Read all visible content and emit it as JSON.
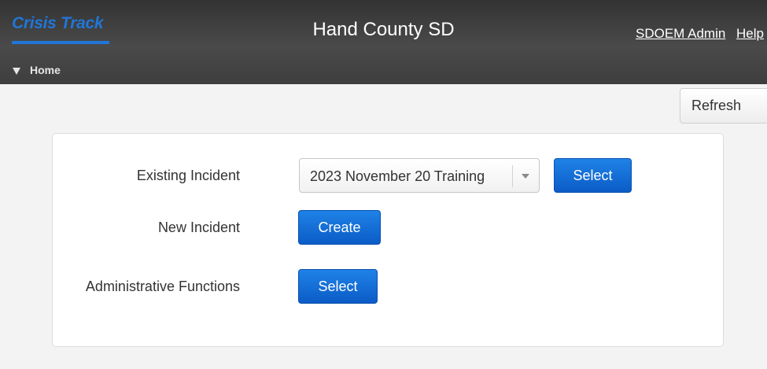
{
  "header": {
    "logo_text": "Crisis Track",
    "county_name": "Hand County SD",
    "user_link": "SDOEM Admin",
    "help_link": "Help",
    "nav_home": "Home"
  },
  "toolbar": {
    "refresh_label": "Refresh"
  },
  "form": {
    "existing_incident": {
      "label": "Existing Incident",
      "selected_value": "2023 November 20 Training",
      "button_label": "Select"
    },
    "new_incident": {
      "label": "New Incident",
      "button_label": "Create"
    },
    "admin_functions": {
      "label": "Administrative Functions",
      "button_label": "Select"
    }
  },
  "icons": {
    "nav_toggle": "triangle-down-icon",
    "combo_arrow": "chevron-down-icon"
  },
  "colors": {
    "header_bg": "#3a3a3a",
    "logo": "#2176d8",
    "primary_button": "#0b6bd6",
    "page_bg": "#f3f3f3"
  }
}
